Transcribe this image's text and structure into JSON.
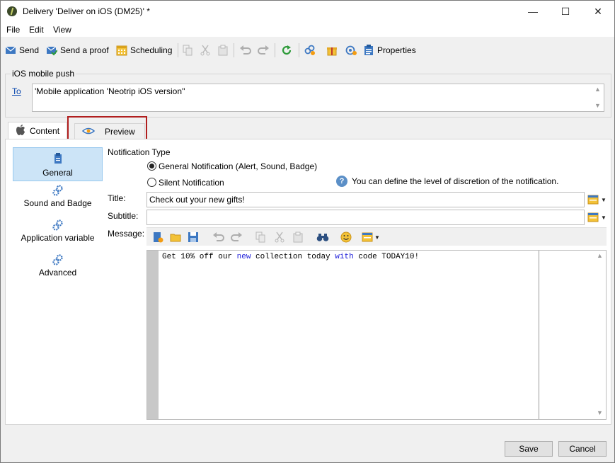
{
  "window": {
    "title": "Delivery 'Deliver on iOS (DM25)' *",
    "controls": [
      "—",
      "☐",
      "✕"
    ]
  },
  "menu": [
    "File",
    "Edit",
    "View"
  ],
  "toolbar": {
    "send_label": "Send",
    "send_proof_label": "Send a proof",
    "scheduling_label": "Scheduling",
    "properties_label": "Properties"
  },
  "recipients": {
    "group_label": "iOS mobile push",
    "to_label": "To",
    "to_value": "'Mobile application 'Neotrip iOS version''"
  },
  "tabs": [
    {
      "label": "Content",
      "active": true
    },
    {
      "label": "Preview",
      "active": false
    }
  ],
  "sidebar": {
    "items": [
      {
        "label": "General",
        "active": true
      },
      {
        "label": "Sound and Badge",
        "active": false
      },
      {
        "label": "Application variable",
        "active": false
      },
      {
        "label": "Advanced",
        "active": false
      }
    ]
  },
  "form": {
    "notification_type_label": "Notification Type",
    "option_general": "General Notification (Alert, Sound, Badge)",
    "option_silent": "Silent Notification",
    "selected_option": "general",
    "help_text": "You can define the level of discretion of the notification.",
    "title_label": "Title:",
    "title_value": "Check out your new gifts!",
    "subtitle_label": "Subtitle:",
    "subtitle_value": "",
    "message_label": "Message:"
  },
  "editor": {
    "parts": [
      {
        "text": "Get 10% off our ",
        "kw": false
      },
      {
        "text": "new",
        "kw": true
      },
      {
        "text": " collection today ",
        "kw": false
      },
      {
        "text": "with",
        "kw": true
      },
      {
        "text": " code TODAY10!",
        "kw": false
      }
    ]
  },
  "footer": {
    "save_label": "Save",
    "cancel_label": "Cancel"
  },
  "colors": {
    "highlight_border": "#b01e1e",
    "active_side_bg": "#cce4f7",
    "link": "#0645ad",
    "keyword": "#1a1ad8"
  }
}
